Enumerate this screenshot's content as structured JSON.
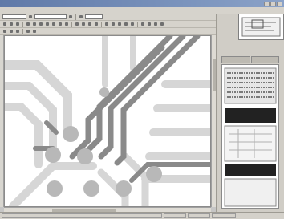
{
  "window": {
    "title": "",
    "titlebar_color": "#6f88b6"
  },
  "menu": {
    "items": [
      "",
      "",
      "",
      "",
      "",
      "",
      "",
      "",
      "",
      "",
      "",
      "",
      "",
      ""
    ]
  },
  "toolbar": {
    "layer_combo": "",
    "zoom_combo": ""
  },
  "status": {
    "fields": [
      "",
      "",
      "",
      ""
    ]
  },
  "colors": {
    "trace": "#8a8a8a",
    "pad": "#b4b4b4",
    "board": "#ffffff"
  }
}
